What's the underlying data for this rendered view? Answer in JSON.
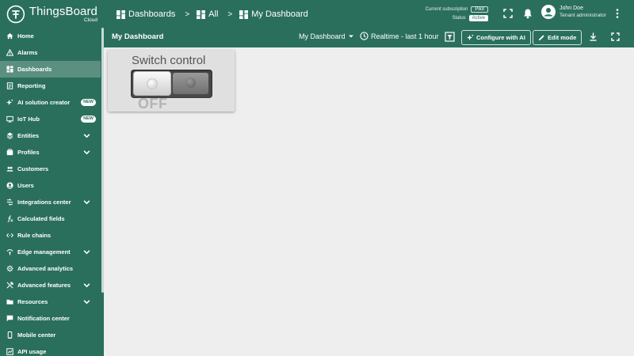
{
  "app": {
    "name": "ThingsBoard",
    "edition": "Cloud"
  },
  "breadcrumb": [
    {
      "label": "Dashboards",
      "icon": "dashboard-icon"
    },
    {
      "label": "All",
      "icon": "dashboard-icon"
    },
    {
      "label": "My Dashboard",
      "icon": "dashboard-icon"
    }
  ],
  "subscription": {
    "current_label": "Current subscription",
    "current_value": "Pilot",
    "status_label": "Status",
    "status_value": "Active"
  },
  "user": {
    "name": "John Doe",
    "role": "Tenant administrator"
  },
  "sidebar": {
    "items": [
      {
        "label": "Home",
        "icon": "home-icon"
      },
      {
        "label": "Alarms",
        "icon": "alarm-icon"
      },
      {
        "label": "Dashboards",
        "icon": "dashboard-icon",
        "active": true
      },
      {
        "label": "Reporting",
        "icon": "report-icon"
      },
      {
        "label": "AI solution creator",
        "icon": "sparkle-icon",
        "badge": "NEW"
      },
      {
        "label": "IoT Hub",
        "icon": "hub-icon",
        "badge": "NEW"
      },
      {
        "label": "Entities",
        "icon": "entities-icon",
        "expandable": true
      },
      {
        "label": "Profiles",
        "icon": "profiles-icon",
        "expandable": true
      },
      {
        "label": "Customers",
        "icon": "customers-icon"
      },
      {
        "label": "Users",
        "icon": "user-icon"
      },
      {
        "label": "Integrations center",
        "icon": "integrations-icon",
        "expandable": true
      },
      {
        "label": "Calculated fields",
        "icon": "function-icon"
      },
      {
        "label": "Rule chains",
        "icon": "code-icon"
      },
      {
        "label": "Edge management",
        "icon": "edge-icon",
        "expandable": true
      },
      {
        "label": "Advanced analytics",
        "icon": "analytics-icon"
      },
      {
        "label": "Advanced features",
        "icon": "tools-icon",
        "expandable": true
      },
      {
        "label": "Resources",
        "icon": "folder-icon",
        "expandable": true
      },
      {
        "label": "Notification center",
        "icon": "notification-icon"
      },
      {
        "label": "Mobile center",
        "icon": "mobile-icon"
      },
      {
        "label": "API usage",
        "icon": "api-icon"
      }
    ]
  },
  "dashboard": {
    "title": "My Dashboard",
    "state_select": "My Dashboard",
    "timewindow": "Realtime - last 1 hour",
    "configure_ai_label": "Configure with AI",
    "edit_mode_label": "Edit mode"
  },
  "widget": {
    "title": "Switch control",
    "state_text": "OFF",
    "value": false
  },
  "colors": {
    "primary": "#2a6f5c",
    "active_item": "#5b8f80",
    "background": "#eeeeee"
  }
}
